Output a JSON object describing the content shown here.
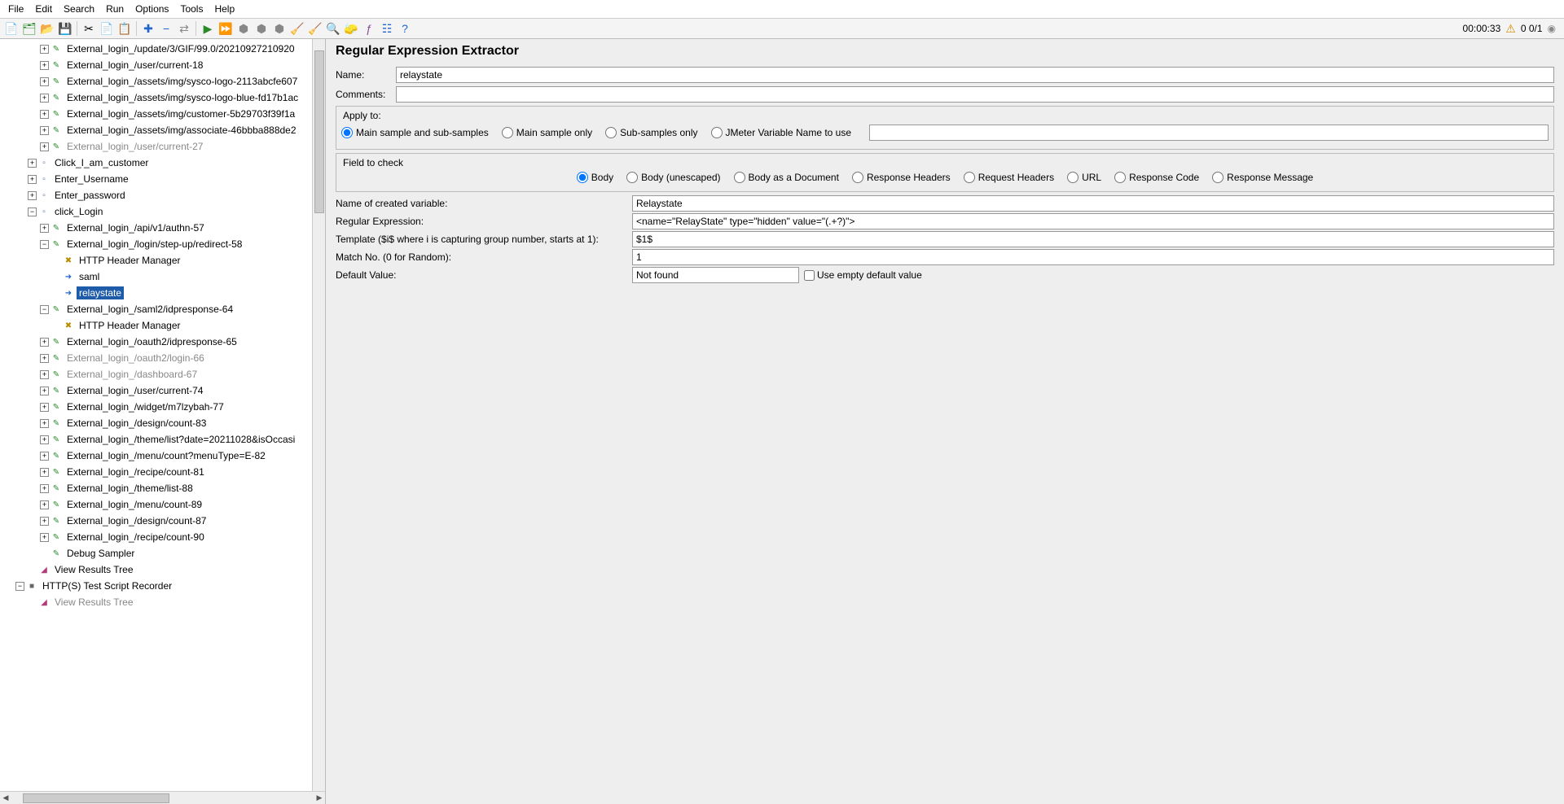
{
  "menu": {
    "items": [
      "File",
      "Edit",
      "Search",
      "Run",
      "Options",
      "Tools",
      "Help"
    ]
  },
  "status": {
    "time": "00:00:33",
    "counts": "0  0/1"
  },
  "tree": [
    {
      "d": 3,
      "e": "+",
      "i": "req",
      "t": "External_login_/update/3/GIF/99.0/20210927210920",
      "dis": false,
      "trunc": true
    },
    {
      "d": 3,
      "e": "+",
      "i": "req",
      "t": "External_login_/user/current-18"
    },
    {
      "d": 3,
      "e": "+",
      "i": "req",
      "t": "External_login_/assets/img/sysco-logo-2113abcfe607",
      "trunc": true
    },
    {
      "d": 3,
      "e": "+",
      "i": "req",
      "t": "External_login_/assets/img/sysco-logo-blue-fd17b1ac",
      "trunc": true
    },
    {
      "d": 3,
      "e": "+",
      "i": "req",
      "t": "External_login_/assets/img/customer-5b29703f39f1a",
      "trunc": true
    },
    {
      "d": 3,
      "e": "+",
      "i": "req",
      "t": "External_login_/assets/img/associate-46bbba888de2",
      "trunc": true
    },
    {
      "d": 3,
      "e": "+",
      "i": "req",
      "t": "External_login_/user/current-27",
      "dis": true
    },
    {
      "d": 2,
      "e": "+",
      "i": "tc",
      "t": "Click_I_am_customer"
    },
    {
      "d": 2,
      "e": "+",
      "i": "tc",
      "t": "Enter_Username"
    },
    {
      "d": 2,
      "e": "+",
      "i": "tc",
      "t": "Enter_password"
    },
    {
      "d": 2,
      "e": "-",
      "i": "tc",
      "t": "click_Login"
    },
    {
      "d": 3,
      "e": "+",
      "i": "req",
      "t": "External_login_/api/v1/authn-57"
    },
    {
      "d": 3,
      "e": "-",
      "i": "req",
      "t": "External_login_/login/step-up/redirect-58"
    },
    {
      "d": 4,
      "e": " ",
      "i": "cfg",
      "t": "HTTP Header Manager"
    },
    {
      "d": 4,
      "e": " ",
      "i": "ext",
      "t": "saml"
    },
    {
      "d": 4,
      "e": " ",
      "i": "ext",
      "t": "relaystate",
      "sel": true
    },
    {
      "d": 3,
      "e": "-",
      "i": "req",
      "t": "External_login_/saml2/idpresponse-64"
    },
    {
      "d": 4,
      "e": " ",
      "i": "cfg",
      "t": "HTTP Header Manager"
    },
    {
      "d": 3,
      "e": "+",
      "i": "req",
      "t": "External_login_/oauth2/idpresponse-65"
    },
    {
      "d": 3,
      "e": "+",
      "i": "req",
      "t": "External_login_/oauth2/login-66",
      "dis": true
    },
    {
      "d": 3,
      "e": "+",
      "i": "req",
      "t": "External_login_/dashboard-67",
      "dis": true
    },
    {
      "d": 3,
      "e": "+",
      "i": "req",
      "t": "External_login_/user/current-74"
    },
    {
      "d": 3,
      "e": "+",
      "i": "req",
      "t": "External_login_/widget/m7lzybah-77"
    },
    {
      "d": 3,
      "e": "+",
      "i": "req",
      "t": "External_login_/design/count-83"
    },
    {
      "d": 3,
      "e": "+",
      "i": "req",
      "t": "External_login_/theme/list?date=20211028&isOccasi",
      "trunc": true
    },
    {
      "d": 3,
      "e": "+",
      "i": "req",
      "t": "External_login_/menu/count?menuType=E-82"
    },
    {
      "d": 3,
      "e": "+",
      "i": "req",
      "t": "External_login_/recipe/count-81"
    },
    {
      "d": 3,
      "e": "+",
      "i": "req",
      "t": "External_login_/theme/list-88"
    },
    {
      "d": 3,
      "e": "+",
      "i": "req",
      "t": "External_login_/menu/count-89"
    },
    {
      "d": 3,
      "e": "+",
      "i": "req",
      "t": "External_login_/design/count-87"
    },
    {
      "d": 3,
      "e": "+",
      "i": "req",
      "t": "External_login_/recipe/count-90"
    },
    {
      "d": 3,
      "e": " ",
      "i": "dbg",
      "t": "Debug Sampler"
    },
    {
      "d": 2,
      "e": " ",
      "i": "vrt",
      "t": "View Results Tree"
    },
    {
      "d": 1,
      "e": "-",
      "i": "rec",
      "t": "HTTP(S) Test Script Recorder"
    },
    {
      "d": 2,
      "e": " ",
      "i": "vrt",
      "t": "View Results Tree",
      "dis": true
    }
  ],
  "panel": {
    "title": "Regular Expression Extractor",
    "name_label": "Name:",
    "name_value": "relaystate",
    "comments_label": "Comments:",
    "comments_value": "",
    "apply_to": {
      "label": "Apply to:",
      "options": [
        "Main sample and sub-samples",
        "Main sample only",
        "Sub-samples only",
        "JMeter Variable Name to use"
      ],
      "selected": 0
    },
    "field_check": {
      "label": "Field to check",
      "options": [
        "Body",
        "Body (unescaped)",
        "Body as a Document",
        "Response Headers",
        "Request Headers",
        "URL",
        "Response Code",
        "Response Message"
      ],
      "selected": 0
    },
    "fields": {
      "varname_label": "Name of created variable:",
      "varname_value": "Relaystate",
      "regex_label": "Regular Expression:",
      "regex_value": "<name=\"RelayState\" type=\"hidden\" value=\"(.+?)\">",
      "template_label": "Template ($i$ where i is capturing group number, starts at 1):",
      "template_value": "$1$",
      "matchno_label": "Match No. (0 for Random):",
      "matchno_value": "1",
      "default_label": "Default Value:",
      "default_value": "Not found",
      "empty_label": "Use empty default value"
    }
  }
}
